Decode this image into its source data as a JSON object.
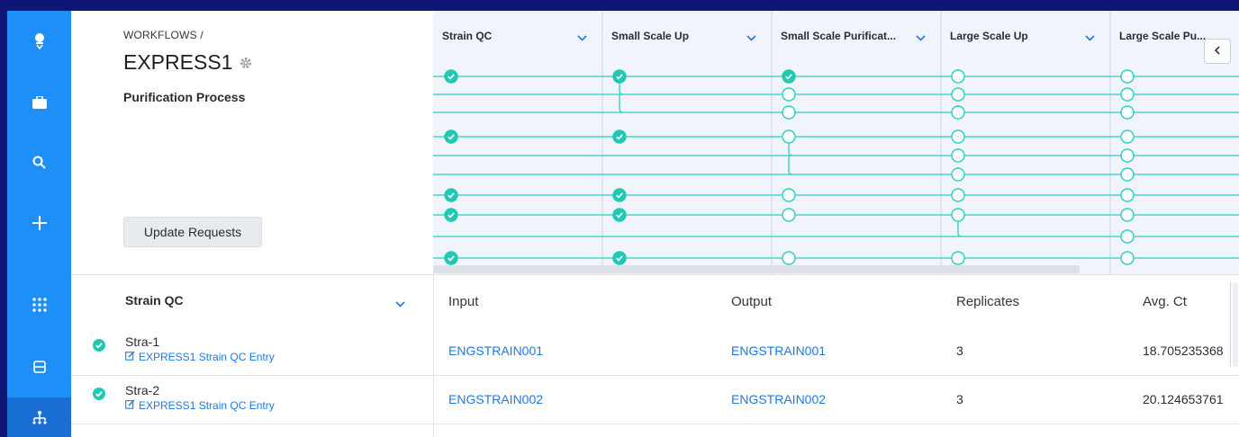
{
  "sidebar": {
    "items": [
      {
        "icon": "robot-icon",
        "label": ""
      },
      {
        "icon": "briefcase-icon",
        "label": ""
      },
      {
        "icon": "search-icon",
        "label": ""
      },
      {
        "icon": "plus-icon",
        "label": ""
      },
      {
        "icon": "apps-grid-icon",
        "label": ""
      },
      {
        "icon": "inventory-icon",
        "label": ""
      },
      {
        "icon": "workflow-tree-icon",
        "label": "",
        "active": true
      }
    ]
  },
  "header": {
    "breadcrumb": "WORKFLOWS /",
    "title": "EXPRESS1",
    "subtitle": "Purification Process",
    "update_button": "Update Requests"
  },
  "graph": {
    "stages": [
      "Strain QC",
      "Small Scale Up",
      "Small Scale Purificat...",
      "Large Scale Up",
      "Large Scale Pu..."
    ],
    "collapse_icon": "chevron-left-icon",
    "node_colors": {
      "done": "#21c9b3",
      "pending": "#ffffff",
      "wire": "#2bd0c0"
    }
  },
  "stage_panel": {
    "title": "Strain QC",
    "strains": [
      {
        "name": "Stra-1",
        "entry": "EXPRESS1 Strain QC Entry",
        "status": "done"
      },
      {
        "name": "Stra-2",
        "entry": "EXPRESS1 Strain QC Entry",
        "status": "done"
      }
    ]
  },
  "table": {
    "columns": [
      "Input",
      "Output",
      "Replicates",
      "Avg. Ct"
    ],
    "rows": [
      {
        "input": "ENGSTRAIN001",
        "output": "ENGSTRAIN001",
        "replicates": "3",
        "avg_ct": "18.705235368"
      },
      {
        "input": "ENGSTRAIN002",
        "output": "ENGSTRAIN002",
        "replicates": "3",
        "avg_ct": "20.124653761"
      }
    ]
  },
  "colors": {
    "sidebar": "#1f8ff8",
    "sidebar_active": "#1a6fd4",
    "accent": "#1f7ae0",
    "frame": "#0f1675"
  }
}
